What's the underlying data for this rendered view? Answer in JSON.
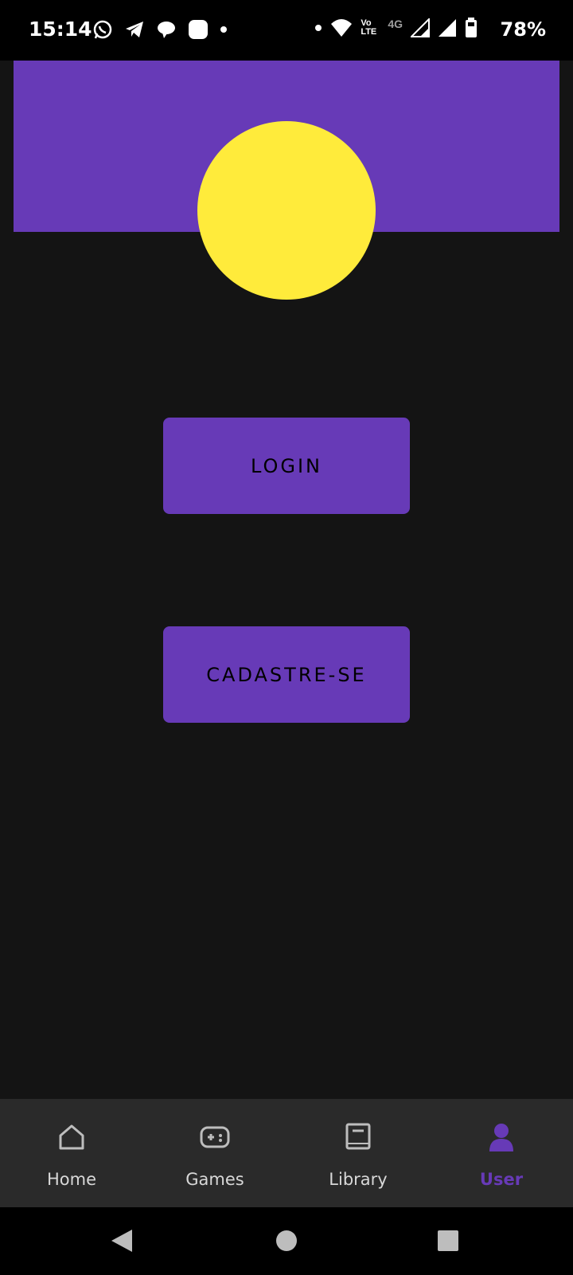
{
  "status_bar": {
    "time": "15:14",
    "battery": "78%",
    "left_icons": [
      "whatsapp-icon",
      "telegram-icon",
      "chat-icon",
      "app-icon",
      "dot-icon"
    ],
    "right_icons": [
      "dot-icon",
      "wifi-icon",
      "volte-icon",
      "4g-icon",
      "signal-icon",
      "signal-icon",
      "battery-icon"
    ],
    "network": "4G",
    "volte_top": "Vo",
    "volte_bottom": "LTE"
  },
  "colors": {
    "accent": "#673ab7",
    "avatar": "#ffeb3b",
    "background": "#141414"
  },
  "buttons": {
    "login_label": "LOGIN",
    "signup_label": "CADASTRE-SE"
  },
  "bottom_nav": {
    "items": [
      {
        "label": "Home",
        "icon": "home-icon",
        "active": false
      },
      {
        "label": "Games",
        "icon": "gamepad-icon",
        "active": false
      },
      {
        "label": "Library",
        "icon": "book-icon",
        "active": false
      },
      {
        "label": "User",
        "icon": "user-icon",
        "active": true
      }
    ]
  },
  "system_nav": [
    "back-icon",
    "home-circle-icon",
    "recents-icon"
  ]
}
